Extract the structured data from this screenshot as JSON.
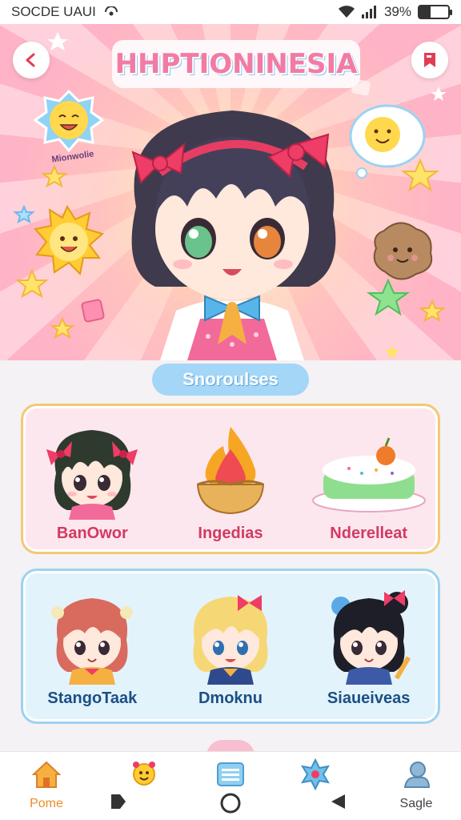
{
  "status_bar": {
    "left_text": "SOCDE UAUI",
    "battery_text": "39%",
    "battery_level": 0.39
  },
  "header": {
    "title": "HHPTIONINESIA",
    "back_icon": "back-arrow-icon",
    "bookmark_icon": "bookmark-icon"
  },
  "hero": {
    "speech_text": "Mionwolie"
  },
  "section": {
    "title": "Snoroulses"
  },
  "cards": [
    {
      "items": [
        {
          "label": "BanOwor",
          "icon": "chibi-girl-ponytail"
        },
        {
          "label": "Ingedias",
          "icon": "flame-tart"
        },
        {
          "label": "Nderelleat",
          "icon": "frosted-cake"
        }
      ]
    },
    {
      "items": [
        {
          "label": "StangoTaak",
          "icon": "chibi-girl-red-hair"
        },
        {
          "label": "Dmoknu",
          "icon": "chibi-girl-blonde"
        },
        {
          "label": "Siaueiveas",
          "icon": "chibi-girl-black-bun"
        }
      ]
    }
  ],
  "bottom_nav": {
    "items": [
      {
        "label": "Pome",
        "icon": "home-icon"
      },
      {
        "label": "",
        "icon": "sun-character-icon"
      },
      {
        "label": "",
        "icon": "list-icon"
      },
      {
        "label": "",
        "icon": "star-badge-icon"
      },
      {
        "label": "Sagle",
        "icon": "profile-icon"
      }
    ]
  },
  "colors": {
    "accent_pink": "#d23a63",
    "accent_blue": "#1b4f84",
    "home_orange": "#f08a24",
    "pill_blue": "#a3d6f7"
  }
}
